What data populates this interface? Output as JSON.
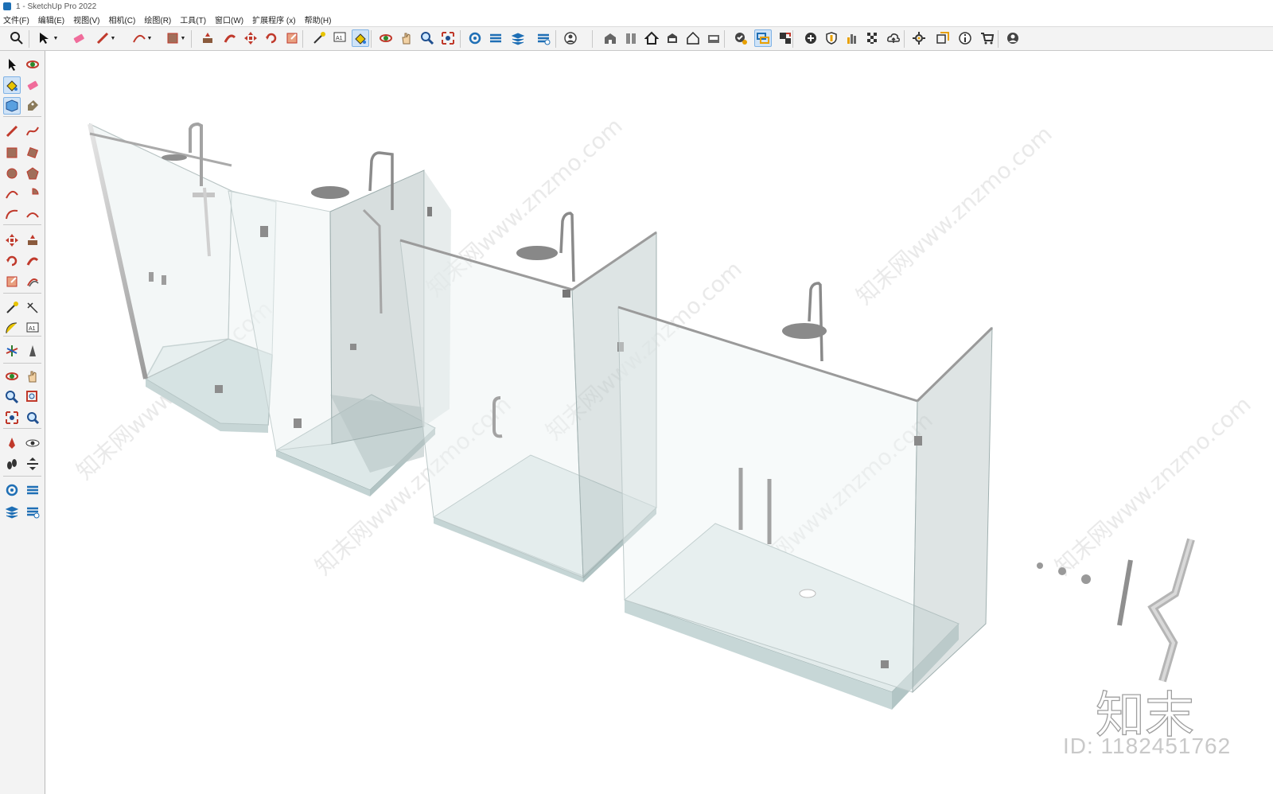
{
  "window": {
    "title": "1 - SketchUp Pro 2022"
  },
  "menu": {
    "items": [
      "文件(F)",
      "编辑(E)",
      "视图(V)",
      "相机(C)",
      "绘图(R)",
      "工具(T)",
      "窗口(W)",
      "扩展程序 (x)",
      "帮助(H)"
    ]
  },
  "top_toolbar": {
    "tools": [
      "search-icon",
      "select-arrow-icon",
      "eraser-icon",
      "pencil-line-icon",
      "arc-icon",
      "rectangle-icon",
      "push-pull-icon",
      "follow-me-icon",
      "move-icon",
      "rotate-icon",
      "scale-icon",
      "tape-measure-icon",
      "text-label-icon",
      "paint-bucket-icon",
      "orbit-icon",
      "pan-icon",
      "zoom-icon",
      "zoom-extents-icon",
      "sandbox-icon",
      "section-icon",
      "layers-icon",
      "styles-icon",
      "account-icon",
      "3d-warehouse-icon",
      "components-icon",
      "house-icon",
      "materials-icon",
      "outline-house-icon",
      "scenes-icon",
      "check-icon",
      "tag-tool-icon",
      "follow-icon",
      "add-icon",
      "shield-icon",
      "chart-icon",
      "checker-icon",
      "cloud-icon",
      "settings-icon",
      "window-icon",
      "info-icon",
      "cart-icon",
      "user-icon"
    ]
  },
  "left_toolbar": {
    "tools": [
      "select-icon",
      "orbit-icon",
      "paint-bucket-icon",
      "eraser-icon",
      "component-icon",
      "tag-icon",
      "line-icon",
      "freehand-icon",
      "rectangle-icon",
      "rotated-rect-icon",
      "circle-icon",
      "polygon-icon",
      "arc-icon",
      "pie-icon",
      "3pt-arc-icon",
      "2pt-arc-icon",
      "move-icon",
      "push-pull-icon",
      "rotate-icon",
      "follow-me-icon",
      "scale-icon",
      "offset-icon",
      "tape-icon",
      "dimension-icon",
      "protractor-icon",
      "text-icon",
      "axes-icon",
      "3d-text-icon",
      "orbit-icon-2",
      "pan-icon",
      "zoom-icon",
      "zoom-window-icon",
      "zoom-extents-icon",
      "previous-view-icon",
      "position-camera-icon",
      "look-around-icon",
      "walk-icon",
      "section-plane-icon",
      "sandbox-icon",
      "sandbox-2-icon",
      "sandbox-3-icon",
      "sandbox-4-icon"
    ]
  },
  "watermarks": {
    "site_text": "知末网www.znzmo.com",
    "logo_text": "知末",
    "id_text": "ID: 1182451762"
  }
}
